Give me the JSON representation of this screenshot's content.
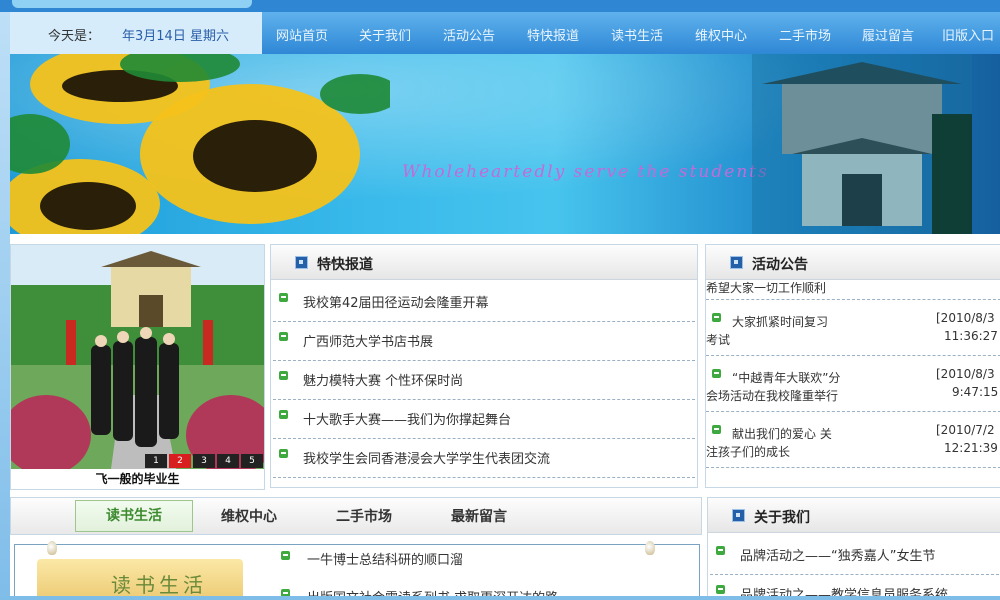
{
  "header": {
    "date_label": "今天是：",
    "date_value": "年3月14日 星期六",
    "nav": [
      "网站首页",
      "关于我们",
      "活动公告",
      "特快报道",
      "读书生活",
      "维权中心",
      "二手市场",
      "履过留言",
      "旧版入口"
    ]
  },
  "banner": {
    "slogan": "Wholeheartedly serve the students"
  },
  "photo": {
    "caption": "飞一般的毕业生",
    "pages": [
      "1",
      "2",
      "3",
      "4",
      "5"
    ],
    "active_page": "2"
  },
  "news": {
    "title": "特快报道",
    "items": [
      "我校第42届田径运动会隆重开幕",
      "广西师范大学书店书展",
      "魅力模特大赛 个性环保时尚",
      "十大歌手大赛——我们为你撑起舞台",
      "我校学生会同香港浸会大学学生代表团交流"
    ]
  },
  "notice": {
    "title": "活动公告",
    "partial_top": "希望大家一切工作顺利",
    "items": [
      {
        "line1": "大家抓紧时间复习",
        "line2": "考试",
        "date": "[2010/8/3",
        "time": "11:36:27"
      },
      {
        "line1": "“中越青年大联欢”分",
        "line2": "会场活动在我校隆重举行",
        "date": "[2010/8/3",
        "time": "9:47:15"
      },
      {
        "line1": "献出我们的爱心 关",
        "line2": "注孩子们的成长",
        "date": "[2010/7/2",
        "time": "12:21:39"
      }
    ]
  },
  "tabs": {
    "items": [
      "读书生活",
      "维权中心",
      "二手市场",
      "最新留言"
    ],
    "active": "读书生活"
  },
  "reading": {
    "image_label": "读书生活",
    "items": [
      "一牛博士总结科研的顺口溜",
      "出版国文社会需读系列书 求取更深开达的路"
    ]
  },
  "about": {
    "title": "关于我们",
    "items": [
      "品牌活动之——“独秀嘉人”女生节",
      "品牌活动之——教学信息员服务系统"
    ]
  },
  "colors": {
    "nav_bg": "#2f88d6",
    "accent_green": "#3c8a2f",
    "title_icon": "#2460a8"
  }
}
